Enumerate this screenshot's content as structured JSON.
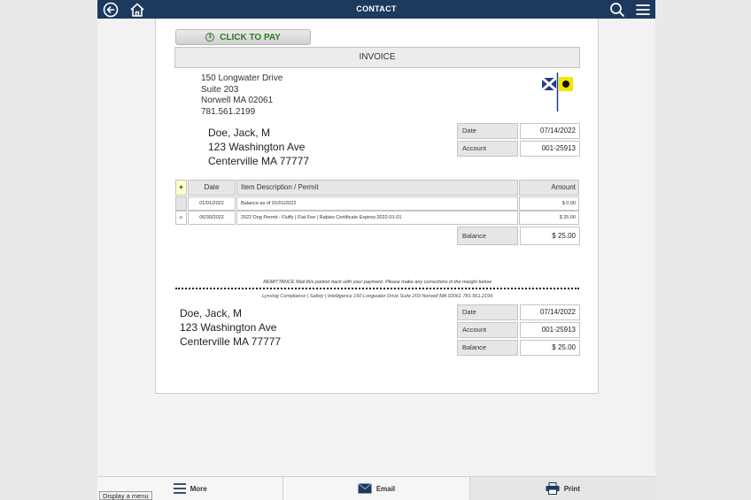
{
  "topbar": {
    "title": "CONTACT",
    "back_icon": "back-arrow-icon",
    "home_icon": "home-icon",
    "search_icon": "search-icon",
    "menu_icon": "hamburger-menu-icon"
  },
  "invoice": {
    "pay_button_label": "CLICK TO PAY",
    "title": "INVOICE",
    "company_address": [
      "150 Longwater Drive",
      "Suite 203",
      "Norwell MA 02061",
      "781.561.2199"
    ],
    "customer": [
      "Doe, Jack, M",
      "123 Washington Ave",
      "Centerville MA 77777"
    ],
    "meta": [
      {
        "label": "Date",
        "value": "07/14/2022"
      },
      {
        "label": "Account",
        "value": "001-25913"
      }
    ],
    "table": {
      "add_label": "+",
      "headers": [
        "Date",
        "Item Description / Permit",
        "Amount"
      ],
      "rows": [
        {
          "marker": "",
          "date": "01/01/2022",
          "description": "Balance as of 01/01/2022",
          "amount": "$ 0.00"
        },
        {
          "marker": "≡",
          "date": "06/30/2022",
          "description": "2022 Dog Permit - Fluffy | Flat Fee | Rabies Certificate Expires:2022-01-01",
          "amount": "$ 25.00"
        }
      ],
      "balance_label": "Balance",
      "balance_value": "$ 25.00"
    }
  },
  "remittance": {
    "note": "REMITTANCE Mail this portion back with your payment. Please make any corrections in the margin below",
    "company_line": "Lynxlog Compliance | Safety | Intelligence 150 Longwater Drive Suite 203 Norwell MA 02061 781.561.2199",
    "customer": [
      "Doe, Jack, M",
      "123 Washington Ave",
      "Centerville MA 77777"
    ],
    "meta": [
      {
        "label": "Date",
        "value": "07/14/2022"
      },
      {
        "label": "Account",
        "value": "001-25913"
      },
      {
        "label": "Balance",
        "value": "$ 25.00"
      }
    ]
  },
  "bottom_bar": {
    "more_label": "More",
    "email_label": "Email",
    "print_label": "Print"
  },
  "tooltip": "Display a menu",
  "colors": {
    "header_bg": "#1c3a5e",
    "pay_text": "#2f7a24",
    "flag_yellow": "#f5e600",
    "flag_blue": "#1f3c8f"
  }
}
